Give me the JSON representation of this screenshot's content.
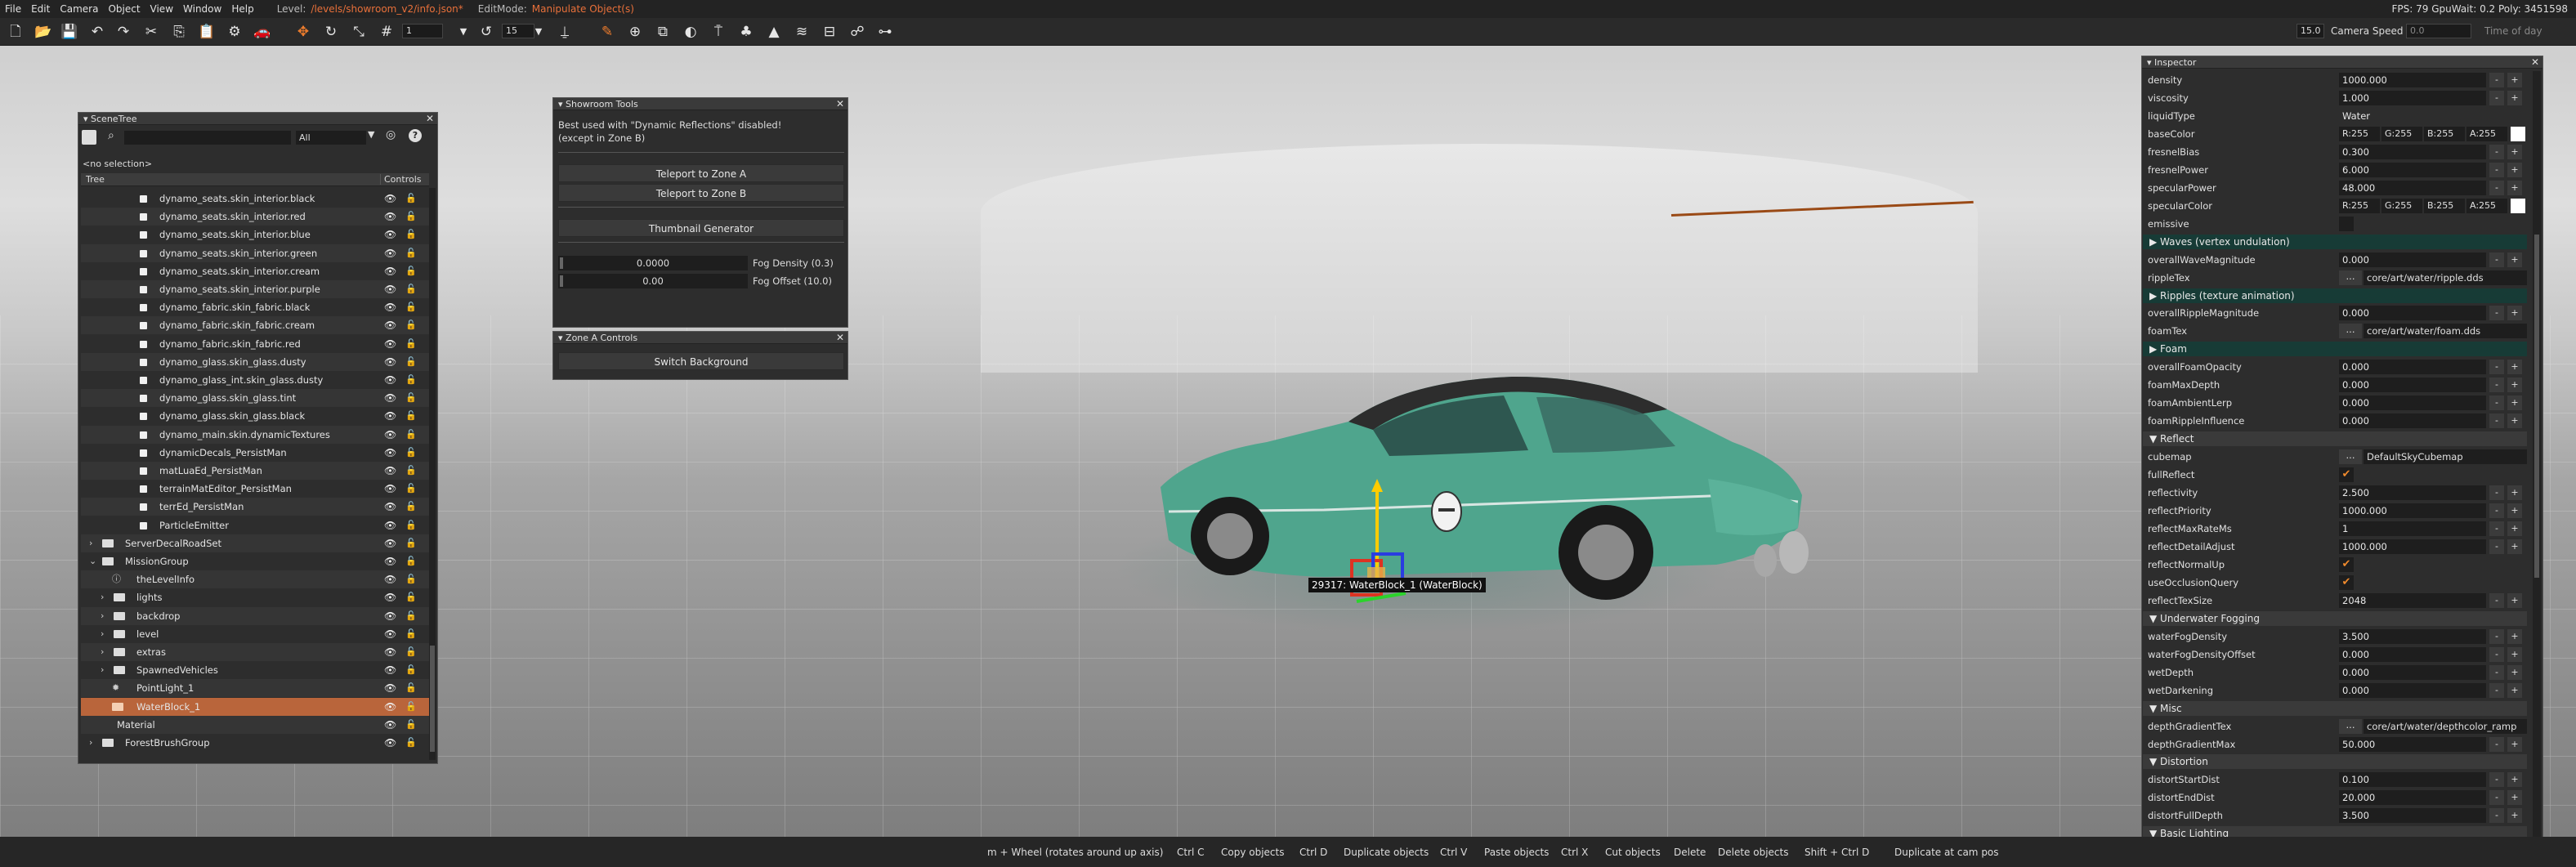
{
  "menubar": {
    "items": [
      "File",
      "Edit",
      "Camera",
      "Object",
      "View",
      "Window",
      "Help"
    ],
    "level_label": "Level:",
    "level_path": "/levels/showroom_v2/info.json*",
    "editmode_label": "EditMode:",
    "editmode_value": "Manipulate Object(s)",
    "fps": "FPS: 79  GpuWait: 0.2   Poly: 3451598"
  },
  "toolbar": {
    "snap_value": "1",
    "rotate_value": "15",
    "camera_speed_num": "15.0",
    "camera_speed_label": "Camera Speed",
    "time_value": "0.0",
    "time_label": "Time of day"
  },
  "scenetree": {
    "title": "SceneTree",
    "filter_value": "All",
    "no_selection": "<no selection>",
    "col_tree": "Tree",
    "col_controls": "Controls",
    "rows": [
      {
        "label": "dynamo_seats.skin_interior.black",
        "indent": 2,
        "kind": "mat"
      },
      {
        "label": "dynamo_seats.skin_interior.red",
        "indent": 2,
        "kind": "mat"
      },
      {
        "label": "dynamo_seats.skin_interior.blue",
        "indent": 2,
        "kind": "mat"
      },
      {
        "label": "dynamo_seats.skin_interior.green",
        "indent": 2,
        "kind": "mat"
      },
      {
        "label": "dynamo_seats.skin_interior.cream",
        "indent": 2,
        "kind": "mat"
      },
      {
        "label": "dynamo_seats.skin_interior.purple",
        "indent": 2,
        "kind": "mat"
      },
      {
        "label": "dynamo_fabric.skin_fabric.black",
        "indent": 2,
        "kind": "mat"
      },
      {
        "label": "dynamo_fabric.skin_fabric.cream",
        "indent": 2,
        "kind": "mat"
      },
      {
        "label": "dynamo_fabric.skin_fabric.red",
        "indent": 2,
        "kind": "mat"
      },
      {
        "label": "dynamo_glass.skin_glass.dusty",
        "indent": 2,
        "kind": "mat"
      },
      {
        "label": "dynamo_glass_int.skin_glass.dusty",
        "indent": 2,
        "kind": "mat"
      },
      {
        "label": "dynamo_glass.skin_glass.tint",
        "indent": 2,
        "kind": "mat"
      },
      {
        "label": "dynamo_glass.skin_glass.black",
        "indent": 2,
        "kind": "mat"
      },
      {
        "label": "dynamo_main.skin.dynamicTextures",
        "indent": 2,
        "kind": "mat"
      },
      {
        "label": "dynamicDecals_PersistMan",
        "indent": 2,
        "kind": "mat"
      },
      {
        "label": "matLuaEd_PersistMan",
        "indent": 2,
        "kind": "mat"
      },
      {
        "label": "terrainMatEditor_PersistMan",
        "indent": 2,
        "kind": "mat"
      },
      {
        "label": "terrEd_PersistMan",
        "indent": 2,
        "kind": "mat"
      },
      {
        "label": "ParticleEmitter",
        "indent": 2,
        "kind": "mat"
      },
      {
        "label": "ServerDecalRoadSet",
        "indent": 0,
        "kind": "folder",
        "exp": "›"
      },
      {
        "label": "MissionGroup",
        "indent": 0,
        "kind": "folder",
        "exp": "⌄"
      },
      {
        "label": "theLevelInfo",
        "indent": 1,
        "kind": "info"
      },
      {
        "label": "lights",
        "indent": 1,
        "kind": "folder",
        "exp": "›"
      },
      {
        "label": "backdrop",
        "indent": 1,
        "kind": "folder",
        "exp": "›"
      },
      {
        "label": "level",
        "indent": 1,
        "kind": "folder",
        "exp": "›"
      },
      {
        "label": "extras",
        "indent": 1,
        "kind": "folder",
        "exp": "›"
      },
      {
        "label": "SpawnedVehicles",
        "indent": 1,
        "kind": "folder",
        "exp": "›"
      },
      {
        "label": "PointLight_1",
        "indent": 1,
        "kind": "light"
      },
      {
        "label": "WaterBlock_1",
        "indent": 1,
        "kind": "water",
        "selected": true
      },
      {
        "label": "Material",
        "indent": 0,
        "kind": "plain"
      },
      {
        "label": "ForestBrushGroup",
        "indent": 0,
        "kind": "folder",
        "exp": "›"
      }
    ]
  },
  "showroom": {
    "title": "Showroom Tools",
    "note1": "Best used with \"Dynamic Reflections\" disabled!",
    "note2": "(except in Zone B)",
    "btn_zone_a": "Teleport to Zone A",
    "btn_zone_b": "Teleport to Zone B",
    "btn_thumb": "Thumbnail Generator",
    "fog_density_value": "0.0000",
    "fog_density_label": "Fog Density (0.3)",
    "fog_offset_value": "0.00",
    "fog_offset_label": "Fog Offset (10.0)"
  },
  "zonea": {
    "title": "Zone A Controls",
    "btn_switch": "Switch Background"
  },
  "viewport": {
    "gizmo_label": "29317: WaterBlock_1 (WaterBlock)"
  },
  "inspector": {
    "title": "Inspector",
    "rows": [
      {
        "t": "num",
        "k": "density",
        "v": "1000.000"
      },
      {
        "t": "num",
        "k": "viscosity",
        "v": "1.000"
      },
      {
        "t": "text",
        "k": "liquidType",
        "v": "Water"
      },
      {
        "t": "color",
        "k": "baseColor",
        "r": "R:255",
        "g": "G:255",
        "b": "B:255",
        "a": "A:255"
      },
      {
        "t": "num",
        "k": "fresnelBias",
        "v": "0.300"
      },
      {
        "t": "num",
        "k": "fresnelPower",
        "v": "6.000"
      },
      {
        "t": "num",
        "k": "specularPower",
        "v": "48.000"
      },
      {
        "t": "color",
        "k": "specularColor",
        "r": "R:255",
        "g": "G:255",
        "b": "B:255",
        "a": "A:255"
      },
      {
        "t": "check",
        "k": "emissive",
        "v": ""
      },
      {
        "t": "secd",
        "k": "▶ Waves (vertex undulation)"
      },
      {
        "t": "num",
        "k": "overallWaveMagnitude",
        "v": "0.000"
      },
      {
        "t": "path",
        "k": "rippleTex",
        "v": "core/art/water/ripple.dds"
      },
      {
        "t": "secd",
        "k": "▶ Ripples (texture animation)"
      },
      {
        "t": "num",
        "k": "overallRippleMagnitude",
        "v": "0.000"
      },
      {
        "t": "path",
        "k": "foamTex",
        "v": "core/art/water/foam.dds"
      },
      {
        "t": "secd",
        "k": "▶ Foam"
      },
      {
        "t": "num",
        "k": "overallFoamOpacity",
        "v": "0.000"
      },
      {
        "t": "num",
        "k": "foamMaxDepth",
        "v": "0.000"
      },
      {
        "t": "num",
        "k": "foamAmbientLerp",
        "v": "0.000"
      },
      {
        "t": "num",
        "k": "foamRippleInfluence",
        "v": "0.000"
      },
      {
        "t": "secg",
        "k": "▼ Reflect"
      },
      {
        "t": "path",
        "k": "cubemap",
        "v": "DefaultSkyCubemap"
      },
      {
        "t": "check",
        "k": "fullReflect",
        "v": "✔"
      },
      {
        "t": "num",
        "k": "reflectivity",
        "v": "2.500"
      },
      {
        "t": "num",
        "k": "reflectPriority",
        "v": "1000.000"
      },
      {
        "t": "num",
        "k": "reflectMaxRateMs",
        "v": "1"
      },
      {
        "t": "num",
        "k": "reflectDetailAdjust",
        "v": "1000.000"
      },
      {
        "t": "check",
        "k": "reflectNormalUp",
        "v": "✔"
      },
      {
        "t": "check",
        "k": "useOcclusionQuery",
        "v": "✔"
      },
      {
        "t": "num",
        "k": "reflectTexSize",
        "v": "2048"
      },
      {
        "t": "secg",
        "k": "▼ Underwater Fogging"
      },
      {
        "t": "num",
        "k": "waterFogDensity",
        "v": "3.500"
      },
      {
        "t": "num",
        "k": "waterFogDensityOffset",
        "v": "0.000"
      },
      {
        "t": "num",
        "k": "wetDepth",
        "v": "0.000"
      },
      {
        "t": "num",
        "k": "wetDarkening",
        "v": "0.000"
      },
      {
        "t": "secg",
        "k": "▼ Misc"
      },
      {
        "t": "path",
        "k": "depthGradientTex",
        "v": "core/art/water/depthcolor_ramp"
      },
      {
        "t": "num",
        "k": "depthGradientMax",
        "v": "50.000"
      },
      {
        "t": "secg",
        "k": "▼ Distortion"
      },
      {
        "t": "num",
        "k": "distortStartDist",
        "v": "0.100"
      },
      {
        "t": "num",
        "k": "distortEndDist",
        "v": "20.000"
      },
      {
        "t": "num",
        "k": "distortFullDepth",
        "v": "3.500"
      },
      {
        "t": "secg",
        "k": "▼ Basic Lighting"
      }
    ]
  },
  "statusbar": {
    "items": [
      {
        "key": "",
        "text": "m + Wheel (rotates around up axis)"
      },
      {
        "key": "Ctrl C",
        "text": "Copy objects"
      },
      {
        "key": "Ctrl D",
        "text": "Duplicate objects"
      },
      {
        "key": "Ctrl V",
        "text": "Paste objects"
      },
      {
        "key": "Ctrl X",
        "text": "Cut objects"
      },
      {
        "key": "Delete",
        "text": "Delete objects"
      },
      {
        "key": "Shift + Ctrl D",
        "text": "Duplicate at cam pos"
      }
    ]
  },
  "colors": {
    "accent": "#e8703a",
    "selection": "#b9653b",
    "section_dark": "#173b36",
    "car_body": "#4fa58d"
  }
}
